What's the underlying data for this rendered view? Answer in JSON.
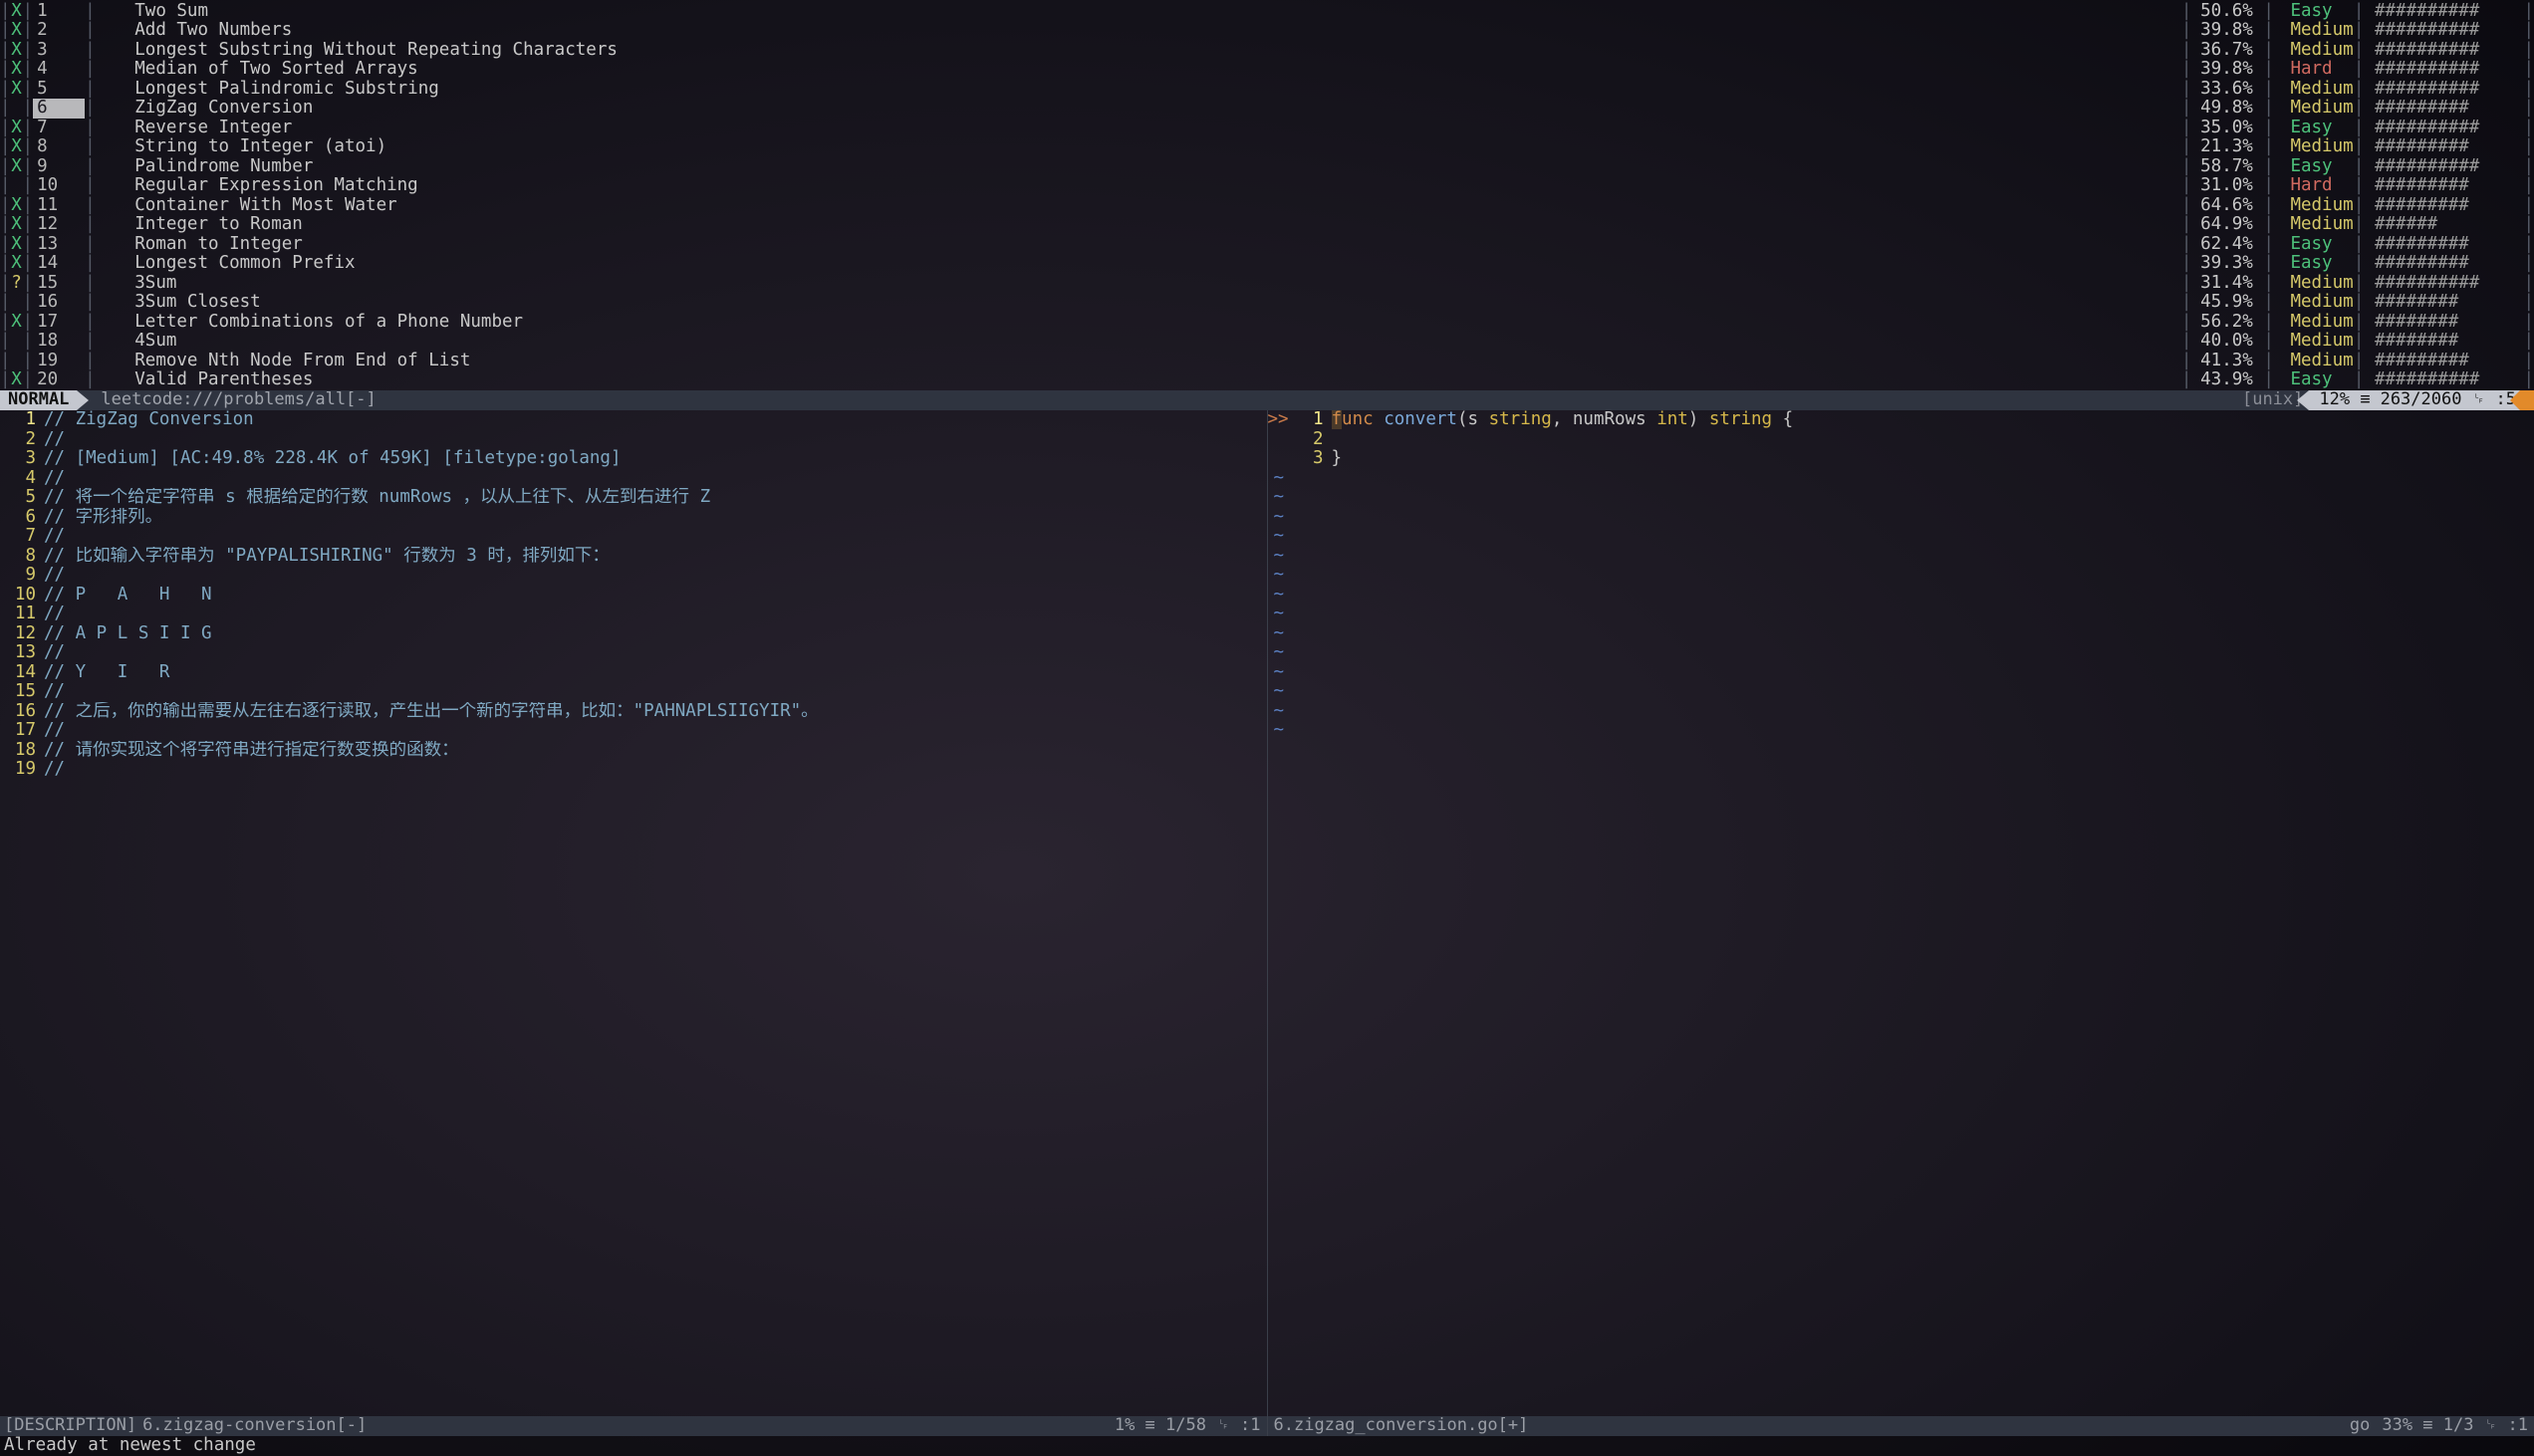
{
  "problem_list": {
    "rows": [
      {
        "mark": "X",
        "num": "1",
        "title": "Two Sum",
        "pct": "50.6%",
        "diff": "Easy",
        "hashes": "##########"
      },
      {
        "mark": "X",
        "num": "2",
        "title": "Add Two Numbers",
        "pct": "39.8%",
        "diff": "Medium",
        "hashes": "##########"
      },
      {
        "mark": "X",
        "num": "3",
        "title": "Longest Substring Without Repeating Characters",
        "pct": "36.7%",
        "diff": "Medium",
        "hashes": "##########"
      },
      {
        "mark": "X",
        "num": "4",
        "title": "Median of Two Sorted Arrays",
        "pct": "39.8%",
        "diff": "Hard",
        "hashes": "##########"
      },
      {
        "mark": "X",
        "num": "5",
        "title": "Longest Palindromic Substring",
        "pct": "33.6%",
        "diff": "Medium",
        "hashes": "##########"
      },
      {
        "mark": "",
        "num": "6",
        "title": "ZigZag Conversion",
        "pct": "49.8%",
        "diff": "Medium",
        "hashes": "#########",
        "cursor": true
      },
      {
        "mark": "X",
        "num": "7",
        "title": "Reverse Integer",
        "pct": "35.0%",
        "diff": "Easy",
        "hashes": "##########"
      },
      {
        "mark": "X",
        "num": "8",
        "title": "String to Integer (atoi)",
        "pct": "21.3%",
        "diff": "Medium",
        "hashes": "#########"
      },
      {
        "mark": "X",
        "num": "9",
        "title": "Palindrome Number",
        "pct": "58.7%",
        "diff": "Easy",
        "hashes": "##########"
      },
      {
        "mark": "",
        "num": "10",
        "title": "Regular Expression Matching",
        "pct": "31.0%",
        "diff": "Hard",
        "hashes": "#########"
      },
      {
        "mark": "X",
        "num": "11",
        "title": "Container With Most Water",
        "pct": "64.6%",
        "diff": "Medium",
        "hashes": "#########"
      },
      {
        "mark": "X",
        "num": "12",
        "title": "Integer to Roman",
        "pct": "64.9%",
        "diff": "Medium",
        "hashes": "######"
      },
      {
        "mark": "X",
        "num": "13",
        "title": "Roman to Integer",
        "pct": "62.4%",
        "diff": "Easy",
        "hashes": "#########"
      },
      {
        "mark": "X",
        "num": "14",
        "title": "Longest Common Prefix",
        "pct": "39.3%",
        "diff": "Easy",
        "hashes": "#########"
      },
      {
        "mark": "?",
        "num": "15",
        "title": "3Sum",
        "pct": "31.4%",
        "diff": "Medium",
        "hashes": "##########"
      },
      {
        "mark": "",
        "num": "16",
        "title": "3Sum Closest",
        "pct": "45.9%",
        "diff": "Medium",
        "hashes": "########"
      },
      {
        "mark": "X",
        "num": "17",
        "title": "Letter Combinations of a Phone Number",
        "pct": "56.2%",
        "diff": "Medium",
        "hashes": "########"
      },
      {
        "mark": "",
        "num": "18",
        "title": "4Sum",
        "pct": "40.0%",
        "diff": "Medium",
        "hashes": "########"
      },
      {
        "mark": "",
        "num": "19",
        "title": "Remove Nth Node From End of List",
        "pct": "41.3%",
        "diff": "Medium",
        "hashes": "#########"
      },
      {
        "mark": "X",
        "num": "20",
        "title": "Valid Parentheses",
        "pct": "43.9%",
        "diff": "Easy",
        "hashes": "##########"
      }
    ]
  },
  "status_top": {
    "mode": "NORMAL",
    "file": "leetcode:///problems/all[-]",
    "unix": "[unix]",
    "pct": "12% ≡",
    "pos": "263/2060 ␊ :5"
  },
  "desc": {
    "lines": [
      {
        "n": "1",
        "t": "// ZigZag Conversion"
      },
      {
        "n": "2",
        "t": "//"
      },
      {
        "n": "3",
        "t": "// [Medium] [AC:49.8% 228.4K of 459K] [filetype:golang]"
      },
      {
        "n": "4",
        "t": "//"
      },
      {
        "n": "5",
        "t": "// 将一个给定字符串 s 根据给定的行数 numRows ，以从上往下、从左到右进行 Z"
      },
      {
        "n": "6",
        "t": "// 字形排列。"
      },
      {
        "n": "7",
        "t": "//"
      },
      {
        "n": "8",
        "t": "// 比如输入字符串为 \"PAYPALISHIRING\" 行数为 3 时，排列如下："
      },
      {
        "n": "9",
        "t": "//"
      },
      {
        "n": "10",
        "t": "// P   A   H   N"
      },
      {
        "n": "11",
        "t": "//"
      },
      {
        "n": "12",
        "t": "// A P L S I I G"
      },
      {
        "n": "13",
        "t": "//"
      },
      {
        "n": "14",
        "t": "// Y   I   R"
      },
      {
        "n": "15",
        "t": "//"
      },
      {
        "n": "16",
        "t": "// 之后，你的输出需要从左往右逐行读取，产生出一个新的字符串，比如：\"PAHNAPLSIIGYIR\"。"
      },
      {
        "n": "17",
        "t": "//"
      },
      {
        "n": "18",
        "t": "// 请你实现这个将字符串进行指定行数变换的函数："
      },
      {
        "n": "19",
        "t": "//"
      }
    ]
  },
  "code": {
    "lines": [
      {
        "n": "1",
        "tokens": [
          [
            "kw",
            "func "
          ],
          [
            "fn",
            "convert"
          ],
          [
            "paren",
            "("
          ],
          [
            "ident",
            "s "
          ],
          [
            "ty",
            "string"
          ],
          [
            "paren",
            ", "
          ],
          [
            "ident",
            "numRows "
          ],
          [
            "ty",
            "int"
          ],
          [
            "paren",
            ") "
          ],
          [
            "ty",
            "string"
          ],
          [
            "paren",
            " {"
          ]
        ]
      },
      {
        "n": "2",
        "tokens": []
      },
      {
        "n": "3",
        "tokens": [
          [
            "paren",
            "}"
          ]
        ]
      }
    ],
    "tilde_count": 14,
    "gutter_mark": ">>"
  },
  "status_bottom": {
    "left": {
      "tag": "[DESCRIPTION]",
      "file": "6.zigzag-conversion[-]",
      "right": "1% ≡ 1/58 ␊ :1"
    },
    "right": {
      "file": "6.zigzag_conversion.go[+]",
      "ft": "go",
      "right": "33% ≡ 1/3 ␊ :1"
    }
  },
  "cmdline": "Already at newest change"
}
